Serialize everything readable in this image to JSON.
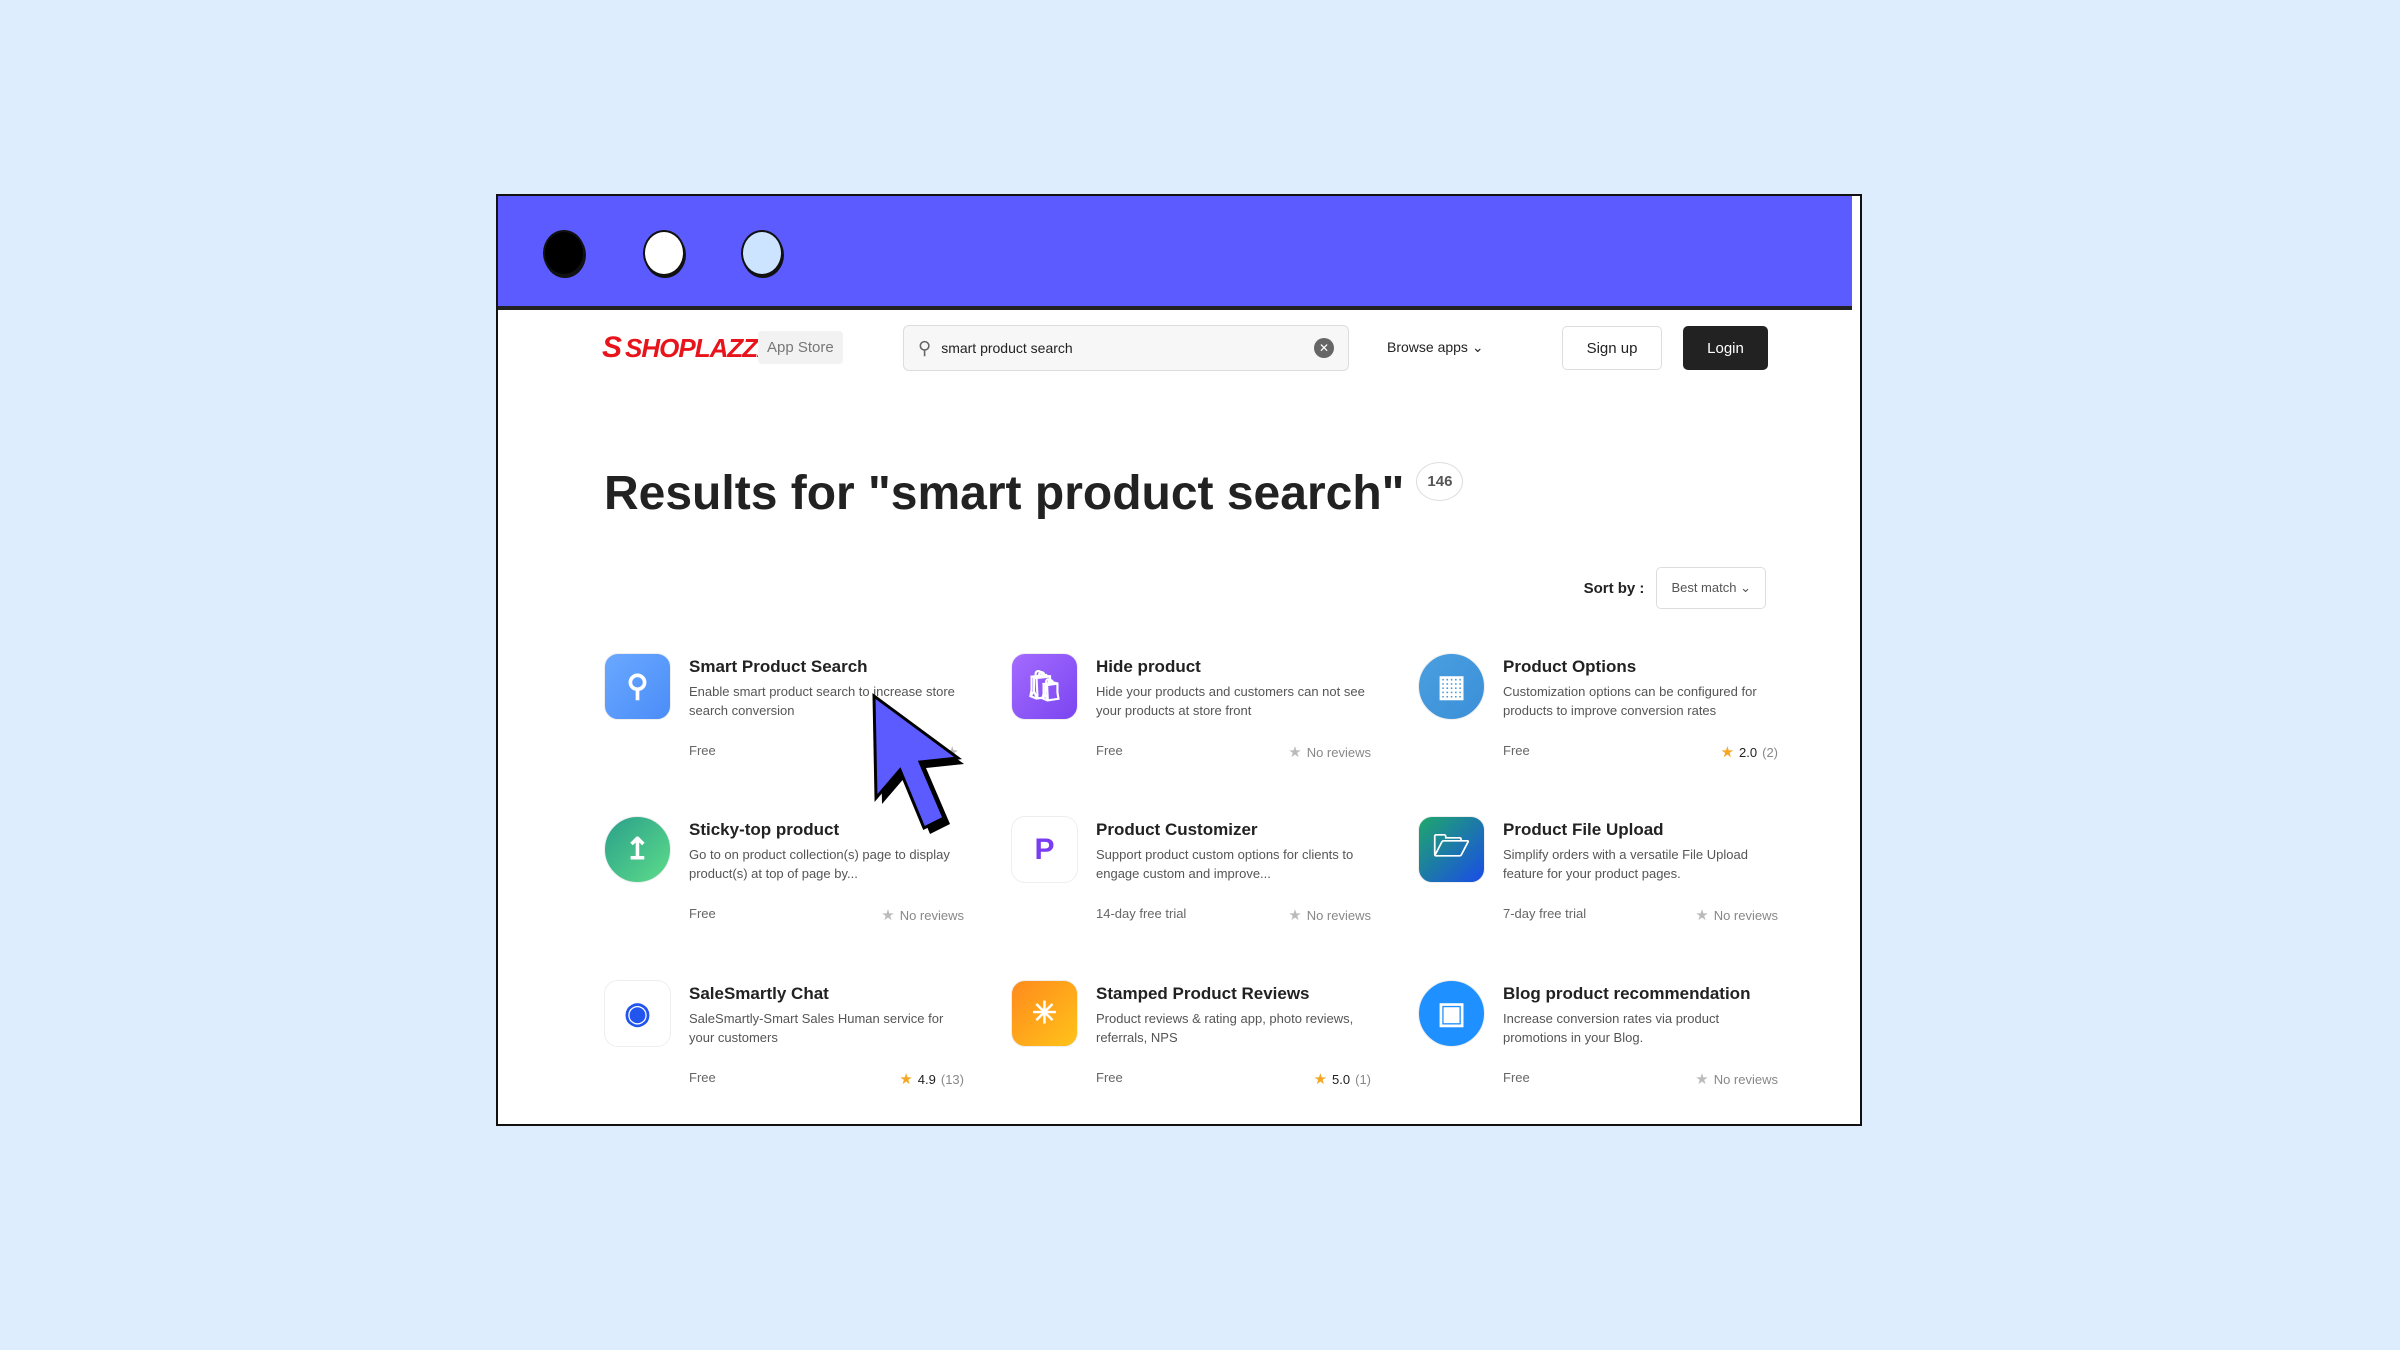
{
  "window": {
    "titlebar_color": "#5b5bff",
    "dots": [
      "#000000",
      "#ffffff",
      "#cce4ff"
    ]
  },
  "header": {
    "logo": "SHOPLAZZA",
    "app_store": "App Store",
    "search_value": "smart product search",
    "browse": "Browse apps",
    "signup": "Sign up",
    "login": "Login"
  },
  "results": {
    "title": "Results for \"smart product search\"",
    "count": "146",
    "sort_label": "Sort by :",
    "sort_value": "Best match"
  },
  "apps": [
    {
      "name": "Smart Product Search",
      "desc": "Enable smart product search to increase store search conversion",
      "price": "Free",
      "rating": "",
      "reviews": "",
      "icon": "magnifier-bulb-icon",
      "colors": [
        "#6aa8ff",
        "#4b8df8"
      ],
      "rated": false
    },
    {
      "name": "Hide product",
      "desc": "Hide your products and customers can not see your products at store front",
      "price": "Free",
      "rating": "",
      "reviews": "No reviews",
      "icon": "shopping-bag-hide-icon",
      "colors": [
        "#a46bff",
        "#7a45f0"
      ],
      "rated": false
    },
    {
      "name": "Product Options",
      "desc": "Customization options can be configured for products to improve conversion rates",
      "price": "Free",
      "rating": "2.0",
      "reviews": "(2)",
      "icon": "options-grid-icon",
      "colors": [
        "#4a9fe0",
        "#3b8fd8"
      ],
      "rated": true
    },
    {
      "name": "Sticky-top product",
      "desc": "Go to on product collection(s) page to display product(s) at top of page by...",
      "price": "Free",
      "rating": "",
      "reviews": "No reviews",
      "icon": "pin-top-icon",
      "colors": [
        "#2aa08a",
        "#5ddc8a"
      ],
      "rated": false
    },
    {
      "name": "Product Customizer",
      "desc": "Support product custom options for clients to engage custom and improve...",
      "price": "14-day free trial",
      "rating": "",
      "reviews": "No reviews",
      "icon": "p-pen-icon",
      "colors": [
        "#ffffff",
        "#ffffff"
      ],
      "rated": false
    },
    {
      "name": "Product File Upload",
      "desc": "Simplify orders with a versatile File Upload feature for your product pages.",
      "price": "7-day free trial",
      "rating": "",
      "reviews": "No reviews",
      "icon": "folder-upload-icon",
      "colors": [
        "#1fa86a",
        "#1a4be8"
      ],
      "rated": false
    },
    {
      "name": "SaleSmartly Chat",
      "desc": "SaleSmartly-Smart Sales Human service for your customers",
      "price": "Free",
      "rating": "4.9",
      "reviews": "(13)",
      "icon": "robot-icon",
      "colors": [
        "#ffffff",
        "#ffffff"
      ],
      "rated": true
    },
    {
      "name": "Stamped Product Reviews",
      "desc": "Product reviews & rating app, photo reviews, referrals, NPS",
      "price": "Free",
      "rating": "5.0",
      "reviews": "(1)",
      "icon": "stamped-burst-icon",
      "colors": [
        "#ff8a1c",
        "#ffc31a"
      ],
      "rated": true
    },
    {
      "name": "Blog product recommendation",
      "desc": "Increase conversion rates via product promotions in your Blog.",
      "price": "Free",
      "rating": "",
      "reviews": "No reviews",
      "icon": "bag-icon",
      "colors": [
        "#1e90ff",
        "#1e90ff"
      ],
      "rated": false
    }
  ]
}
